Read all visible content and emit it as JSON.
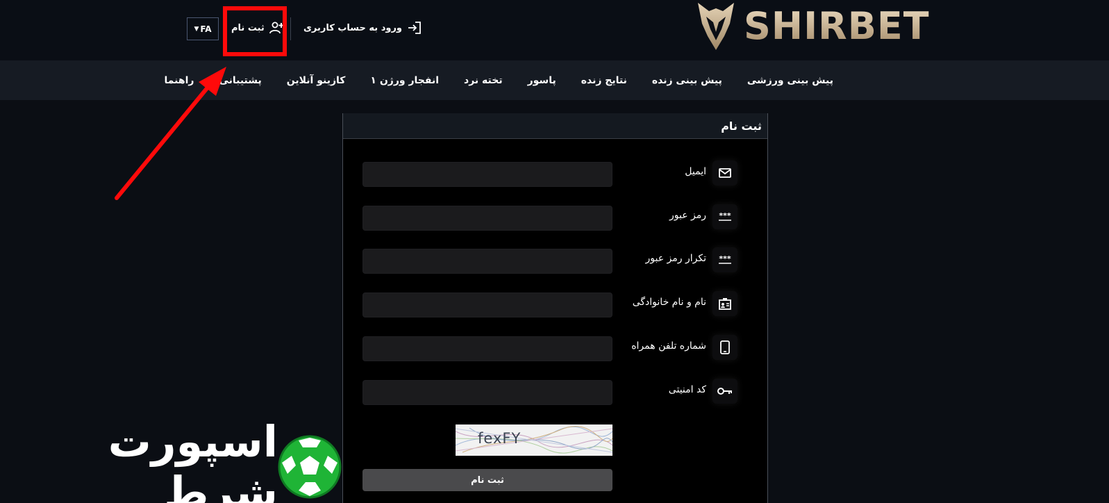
{
  "header": {
    "brand": "SHIRBET",
    "lang": "FA",
    "signup_label": "ثبت نام",
    "login_label": "ورود به حساب کاربری"
  },
  "nav": {
    "items": [
      "پیش بینی ورزشی",
      "پیش بینی زنده",
      "نتایج زنده",
      "پاسور",
      "تخته نرد",
      "انفجار ورژن ۱",
      "کازینو آنلاین",
      "پشتیبانی",
      "راهنما"
    ]
  },
  "form": {
    "title": "ثبت نام",
    "fields": [
      {
        "label": "ایمیل",
        "icon": "mail-icon",
        "value": ""
      },
      {
        "label": "رمز عبور",
        "icon": "password-icon",
        "value": ""
      },
      {
        "label": "تکرار رمز عبور",
        "icon": "password-icon",
        "value": ""
      },
      {
        "label": "نام و نام خانوادگی",
        "icon": "id-card-icon",
        "value": ""
      },
      {
        "label": "شماره تلفن همراه",
        "icon": "mobile-icon",
        "value": ""
      },
      {
        "label": "کد امنیتی",
        "icon": "key-icon",
        "value": ""
      }
    ],
    "captcha_text": "fexFY",
    "submit_label": "ثبت نام"
  },
  "watermark": {
    "text": "اسپورت شرط"
  },
  "colors": {
    "highlight": "#ff0a0a",
    "brand_gold": "#cdb89a",
    "background": "#0b0e14"
  }
}
